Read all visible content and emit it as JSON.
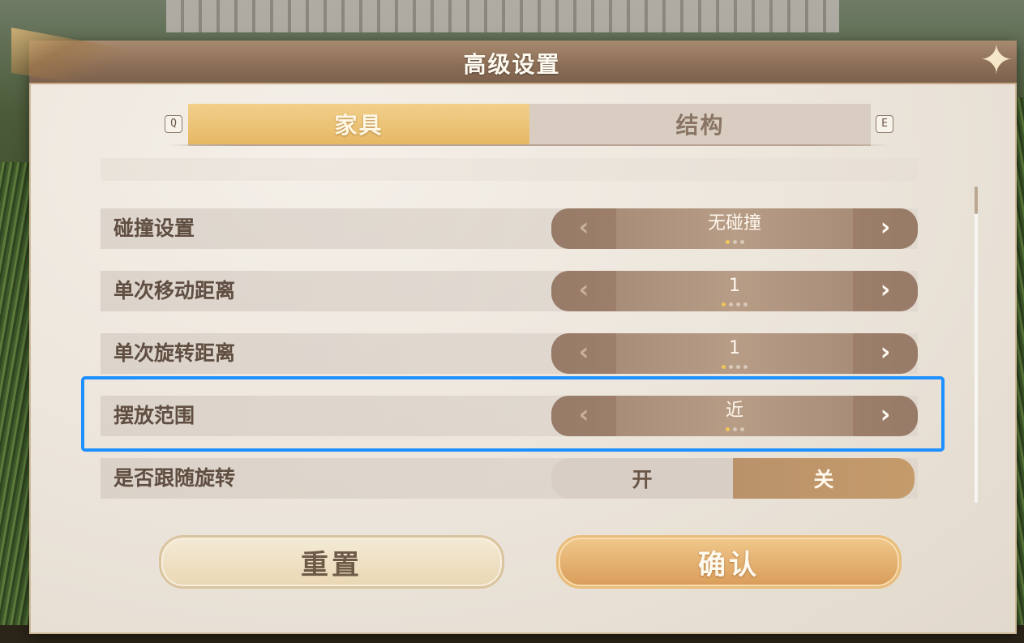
{
  "panel": {
    "title": "高级设置"
  },
  "tabs": {
    "left_key": "Q",
    "right_key": "E",
    "items": [
      {
        "label": "家具",
        "active": true
      },
      {
        "label": "结构",
        "active": false
      }
    ]
  },
  "settings": [
    {
      "label": "碰撞设置",
      "type": "selector",
      "value": "无碰撞",
      "dots": 3,
      "active_dot": 0
    },
    {
      "label": "单次移动距离",
      "type": "selector",
      "value": "1",
      "dots": 4,
      "active_dot": 0
    },
    {
      "label": "单次旋转距离",
      "type": "selector",
      "value": "1",
      "dots": 4,
      "active_dot": 0
    },
    {
      "label": "摆放范围",
      "type": "selector",
      "value": "近",
      "dots": 3,
      "active_dot": 0
    },
    {
      "label": "是否跟随旋转",
      "type": "toggle",
      "on_label": "开",
      "off_label": "关",
      "value": "关"
    }
  ],
  "buttons": {
    "reset": "重置",
    "confirm": "确认"
  },
  "colors": {
    "accent": "#e6b865",
    "highlight": "#1e90ff"
  }
}
